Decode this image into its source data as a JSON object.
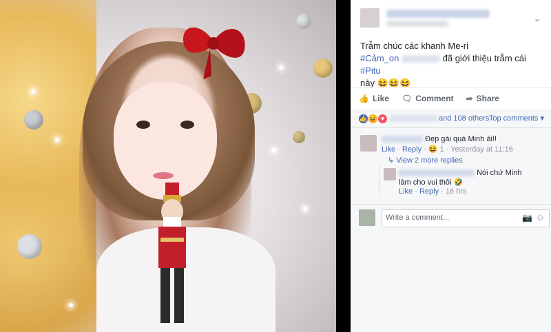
{
  "post": {
    "text_line1": "Trẫm chúc các khanh Me-ri",
    "hashtag1": "#Cảm_on",
    "text_after_tag": "đã giới thiệu trẫm cái",
    "hashtag2": "#Pitu",
    "text_line3": "này 😆😆😆"
  },
  "actions": {
    "like": "Like",
    "comment": "Comment",
    "share": "Share"
  },
  "reactions": {
    "and_others": "and 108 others",
    "top_comments": "Top comments"
  },
  "comments": [
    {
      "text": "Đẹp gái quá Minh ái!!",
      "like": "Like",
      "reply": "Reply",
      "react_count": "1",
      "time": "Yesterday at 11:16"
    }
  ],
  "view_more_replies": "View 2 more replies",
  "reply": {
    "text_line1": "Nói chứ Minh",
    "text_line2": "làm cho vui thôi 🤣",
    "like": "Like",
    "reply": "Reply",
    "time": "16 hrs"
  },
  "composer": {
    "placeholder": "Write a comment..."
  },
  "colors": {
    "link": "#4267b2",
    "text": "#1d2129",
    "meta": "#90949c"
  },
  "icons": [
    "chevron-down-icon",
    "like-icon",
    "comment-icon",
    "share-icon",
    "camera-icon",
    "smiley-icon"
  ]
}
